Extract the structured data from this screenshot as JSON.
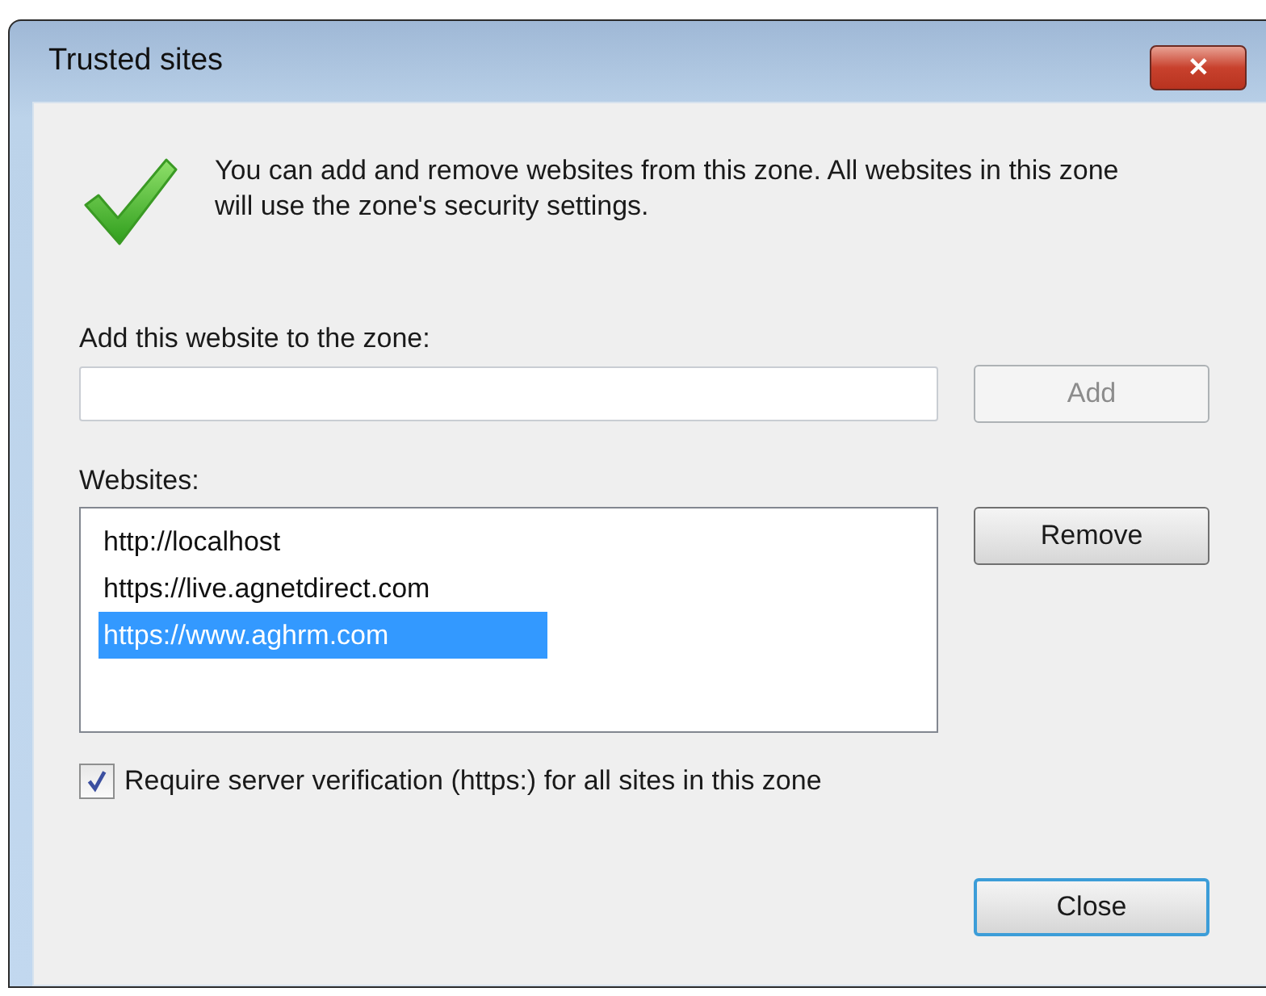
{
  "window": {
    "title": "Trusted sites",
    "close_symbol": "✕"
  },
  "message": "You can add and remove websites from this zone. All websites in this zone will use the zone's security settings.",
  "add_site": {
    "label": "Add this website to the zone:",
    "button": {
      "label": "Add",
      "disabled": true
    }
  },
  "websites": {
    "label": "Websites:",
    "items": [
      {
        "text": "http://localhost",
        "selected": false
      },
      {
        "text": "https://live.agnetdirect.com",
        "selected": false
      },
      {
        "text": "https://www.aghrm.com",
        "selected": true
      }
    ],
    "button": {
      "label": "Remove",
      "disabled": false
    }
  },
  "require_verification": {
    "label": "Require server verification (https:) for all sites in this zone",
    "checked": true
  },
  "close_button": {
    "label": "Close",
    "focused": true
  }
}
